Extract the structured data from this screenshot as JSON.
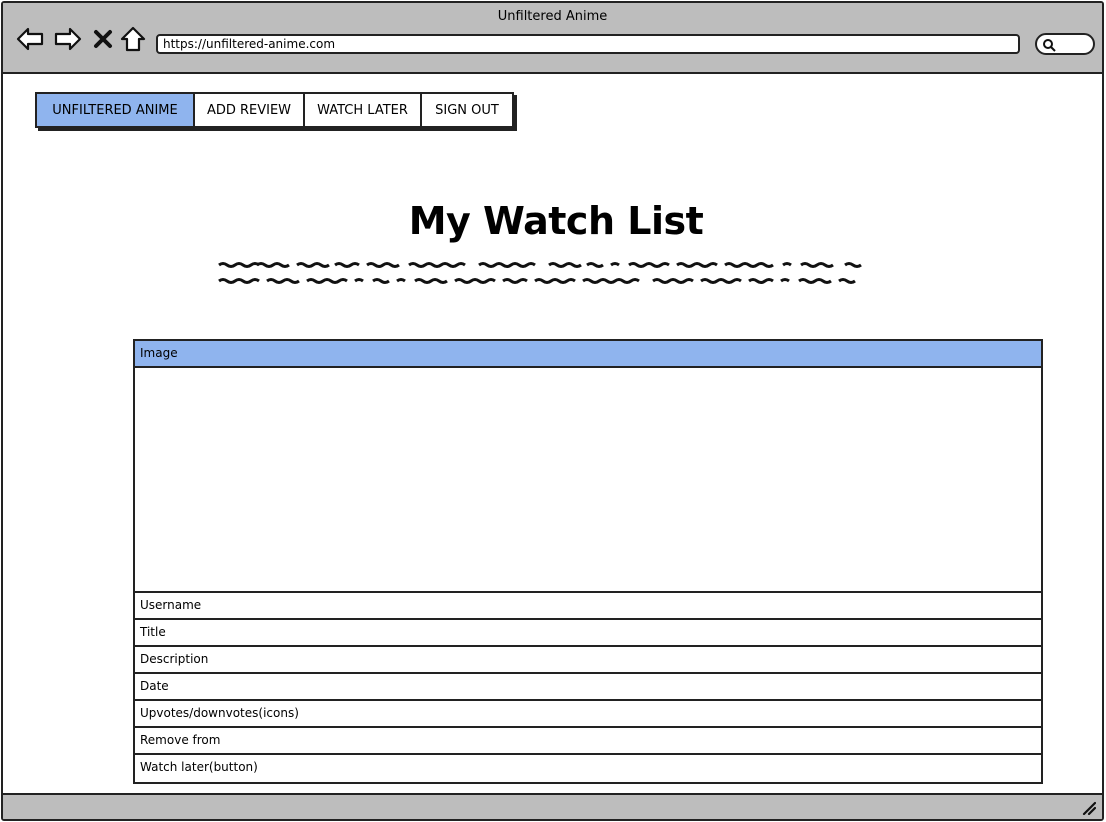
{
  "window": {
    "title": "Unfiltered Anime",
    "url": "https://unfiltered-anime.com"
  },
  "nav": {
    "tabs": [
      {
        "label": "UNFILTERED ANIME",
        "active": true
      },
      {
        "label": "ADD REVIEW",
        "active": false
      },
      {
        "label": "WATCH LATER",
        "active": false
      },
      {
        "label": "SIGN OUT",
        "active": false
      }
    ]
  },
  "page": {
    "title": "My Watch List"
  },
  "card": {
    "header": "Image",
    "rows": [
      "Username",
      "Title",
      "Description",
      "Date",
      "Upvotes/downvotes(icons)",
      "Remove from",
      "Watch later(button)"
    ]
  },
  "colors": {
    "chrome": "#bdbdbd",
    "accent": "#8fb4ee",
    "border": "#222222"
  }
}
